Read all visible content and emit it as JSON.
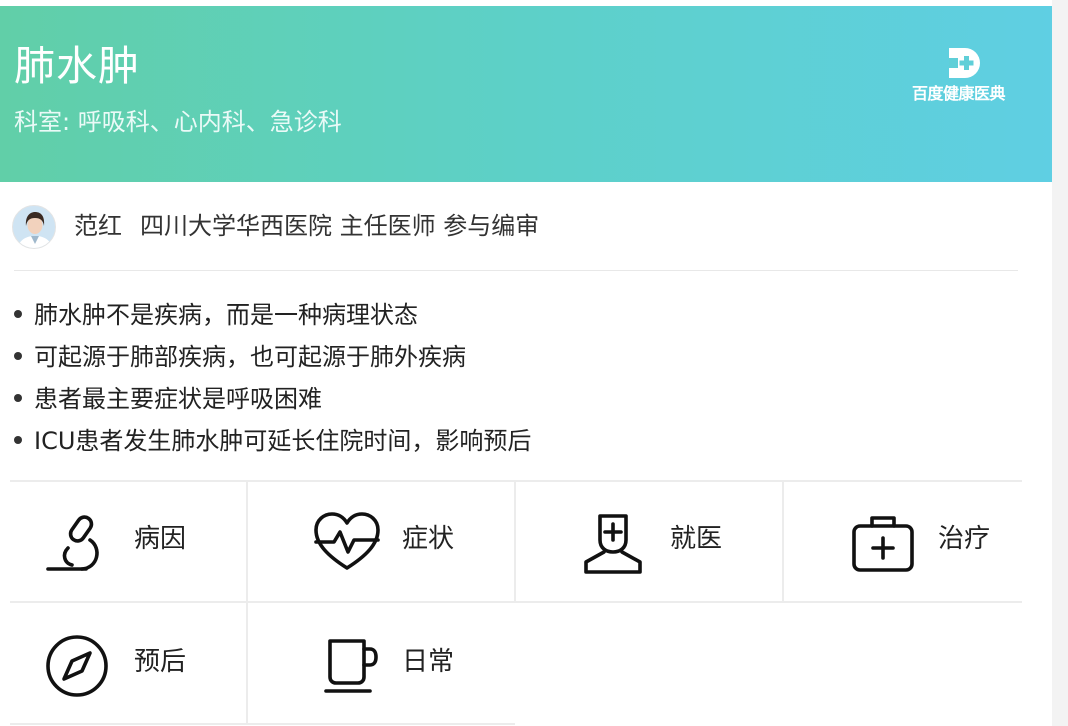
{
  "header": {
    "title": "肺水肿",
    "departments": "科室: 呼吸科、心内科、急诊科",
    "logo_text": "百度健康医典"
  },
  "reviewer": {
    "name": "范红",
    "info": "四川大学华西医院 主任医师 参与编审"
  },
  "key_points": [
    "肺水肿不是疾病，而是一种病理状态",
    "可起源于肺部疾病，也可起源于肺外疾病",
    "患者最主要症状是呼吸困难",
    "ICU患者发生肺水肿可延长住院时间，影响预后"
  ],
  "nav": [
    {
      "label": "病因",
      "icon": "microscope-icon"
    },
    {
      "label": "症状",
      "icon": "heart-pulse-icon"
    },
    {
      "label": "就医",
      "icon": "doctor-icon"
    },
    {
      "label": "治疗",
      "icon": "medical-kit-icon"
    },
    {
      "label": "预后",
      "icon": "compass-icon"
    },
    {
      "label": "日常",
      "icon": "cup-icon"
    }
  ],
  "colors": {
    "header_gradient_start": "#61cfa8",
    "header_gradient_end": "#5fcfe3"
  }
}
